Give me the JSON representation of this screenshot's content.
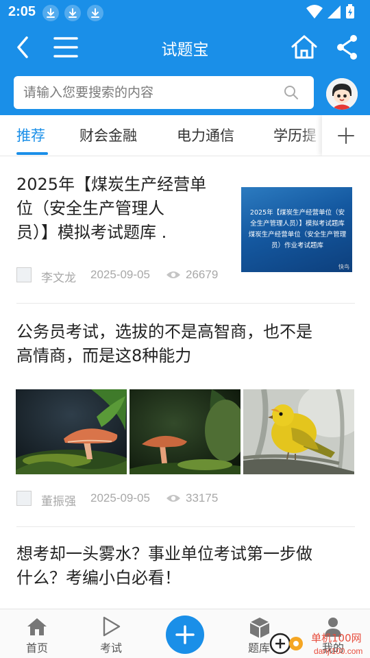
{
  "status_bar": {
    "time": "2:05",
    "notification_icons": [
      "download-icon",
      "download-icon",
      "download-icon"
    ],
    "system_icons": [
      "wifi-icon",
      "signal-icon",
      "battery-charging-icon"
    ]
  },
  "header": {
    "title": "试题宝",
    "icons": [
      "back-icon",
      "menu-icon",
      "home-icon",
      "share-icon"
    ]
  },
  "search": {
    "placeholder": "请输入您要搜索的内容",
    "value": ""
  },
  "tabs": [
    {
      "label": "推荐",
      "active": true
    },
    {
      "label": "财会金融",
      "active": false
    },
    {
      "label": "电力通信",
      "active": false
    },
    {
      "label": "学历提",
      "active": false
    }
  ],
  "articles": [
    {
      "title_lines": [
        "2025年【煤炭生产经营单",
        "位（安全生产管理人",
        "员）】模拟考试题库 ."
      ],
      "thumbnail_text": [
        "2025年【煤炭生产经营单位（安",
        "全生产管理人员）】模拟考试题库",
        "煤炭生产经营单位（安全生产管理",
        "员）作业考试题库"
      ],
      "thumbnail_mark": "快鸟",
      "author": "李文龙",
      "date": "2025-09-05",
      "views": "26679"
    },
    {
      "title_lines": [
        "公务员考试，选拔的不是高智商，也不是",
        "高情商，而是这8种能力"
      ],
      "images": [
        "mushroom-photo",
        "mushroom-photo",
        "yellow-bird-photo"
      ],
      "author": "董振强",
      "date": "2025-09-05",
      "views": "33175"
    },
    {
      "title_lines": [
        "想考却一头雾水？事业单位考试第一步做",
        "什么？考编小白必看！"
      ]
    }
  ],
  "bottom_nav": [
    {
      "label": "首页",
      "icon": "home-icon"
    },
    {
      "label": "考试",
      "icon": "play-icon"
    },
    {
      "label": "",
      "icon": "plus-icon"
    },
    {
      "label": "题库",
      "icon": "cube-icon"
    },
    {
      "label": "我的",
      "icon": "user-icon"
    }
  ],
  "watermark": "单机100网",
  "watermark_url": "danji100.com",
  "colors": {
    "brand": "#1a8fe8",
    "text": "#222222",
    "meta": "#a8a8a8"
  }
}
